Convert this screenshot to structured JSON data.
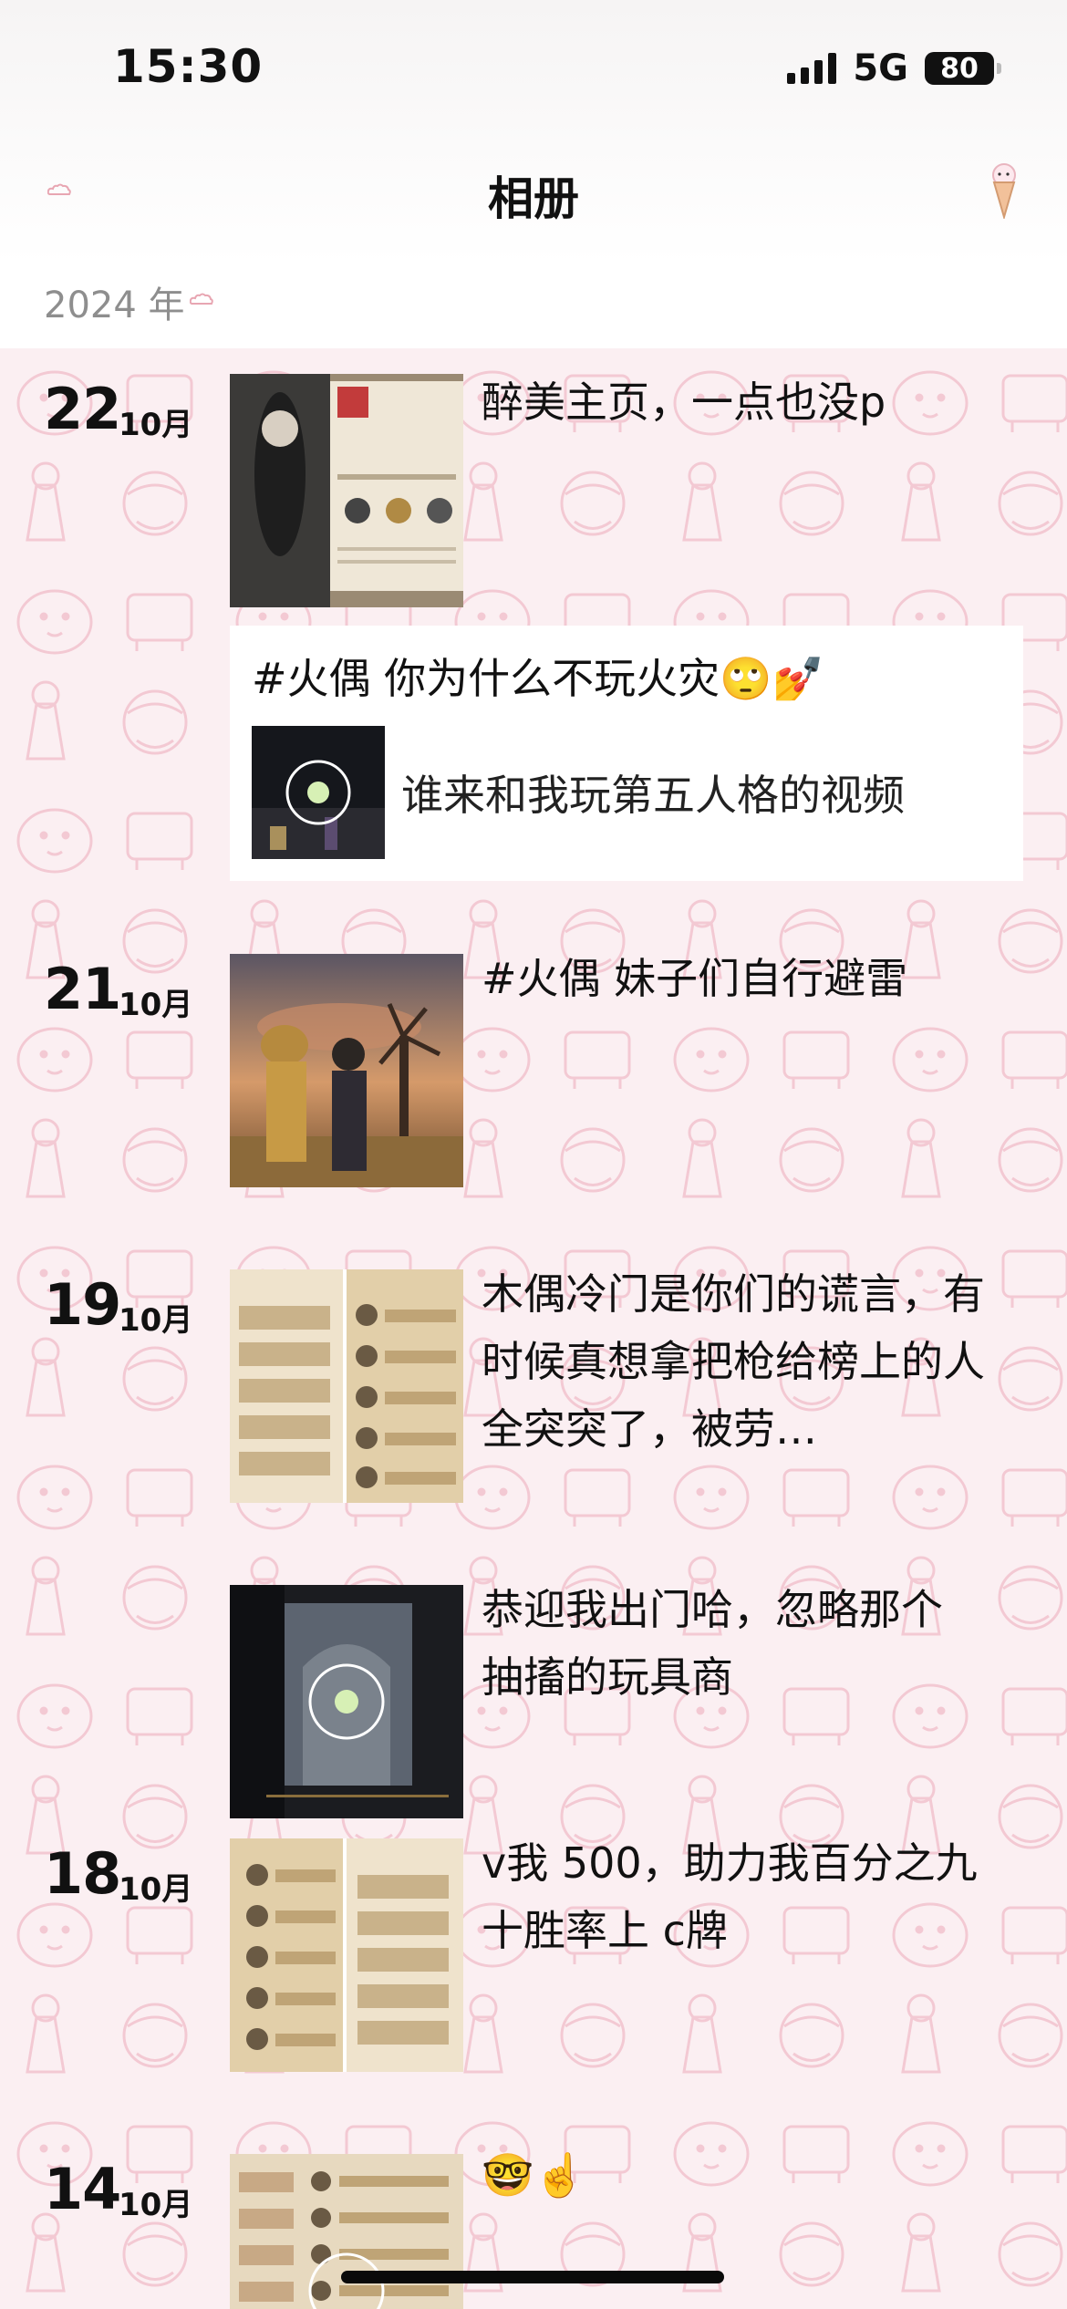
{
  "status": {
    "time": "15:30",
    "network": "5G",
    "battery": "80"
  },
  "nav": {
    "title": "相册",
    "left_icon": "cloud-deco-icon",
    "right_icon": "ice-cream-icon"
  },
  "year": "2024 年",
  "entries": [
    {
      "day": "22",
      "month": "10月",
      "caption": "醉美主页，一点也没p"
    },
    {
      "share_title": "#火偶  你为什么不玩火灾🙄💅",
      "share_text": "谁来和我玩第五人格的视频"
    },
    {
      "day": "21",
      "month": "10月",
      "caption": "#火偶 妹子们自行避雷"
    },
    {
      "day": "19",
      "month": "10月",
      "caption": "木偶冷门是你们的谎言，有时候真想拿把枪给榜上的人全突突了，被劳…"
    },
    {
      "caption": "恭迎我出门哈，忽略那个抽搐的玩具商"
    },
    {
      "day": "18",
      "month": "10月",
      "caption": "v我 500，助力我百分之九十胜率上 c牌"
    },
    {
      "day": "14",
      "month": "10月",
      "caption": "🤓☝️"
    }
  ],
  "colors": {
    "feed_bg": "#fbeff2",
    "pattern": "#f3c9d3"
  }
}
